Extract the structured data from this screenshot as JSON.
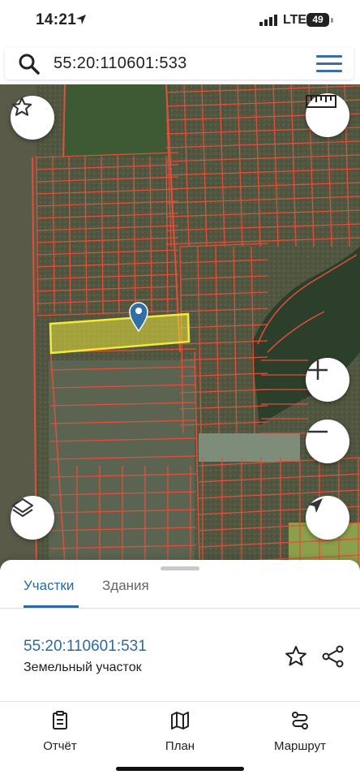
{
  "status_bar": {
    "time": "14:21",
    "network": "LTE",
    "battery": "49"
  },
  "search": {
    "query": "55:20:110601:533"
  },
  "map": {
    "colors": {
      "parcel_border": "#e0503a",
      "selected_parcel": "#e8e23a",
      "marker": "#2f6fa7"
    }
  },
  "sheet": {
    "tabs": [
      {
        "label": "Участки",
        "active": true
      },
      {
        "label": "Здания",
        "active": false
      }
    ],
    "item": {
      "cadastral_number": "55:20:110601:531",
      "type": "Земельный участок"
    }
  },
  "bottom_nav": [
    {
      "label": "Отчёт",
      "icon": "report-icon"
    },
    {
      "label": "План",
      "icon": "map-icon"
    },
    {
      "label": "Маршрут",
      "icon": "route-icon"
    }
  ]
}
